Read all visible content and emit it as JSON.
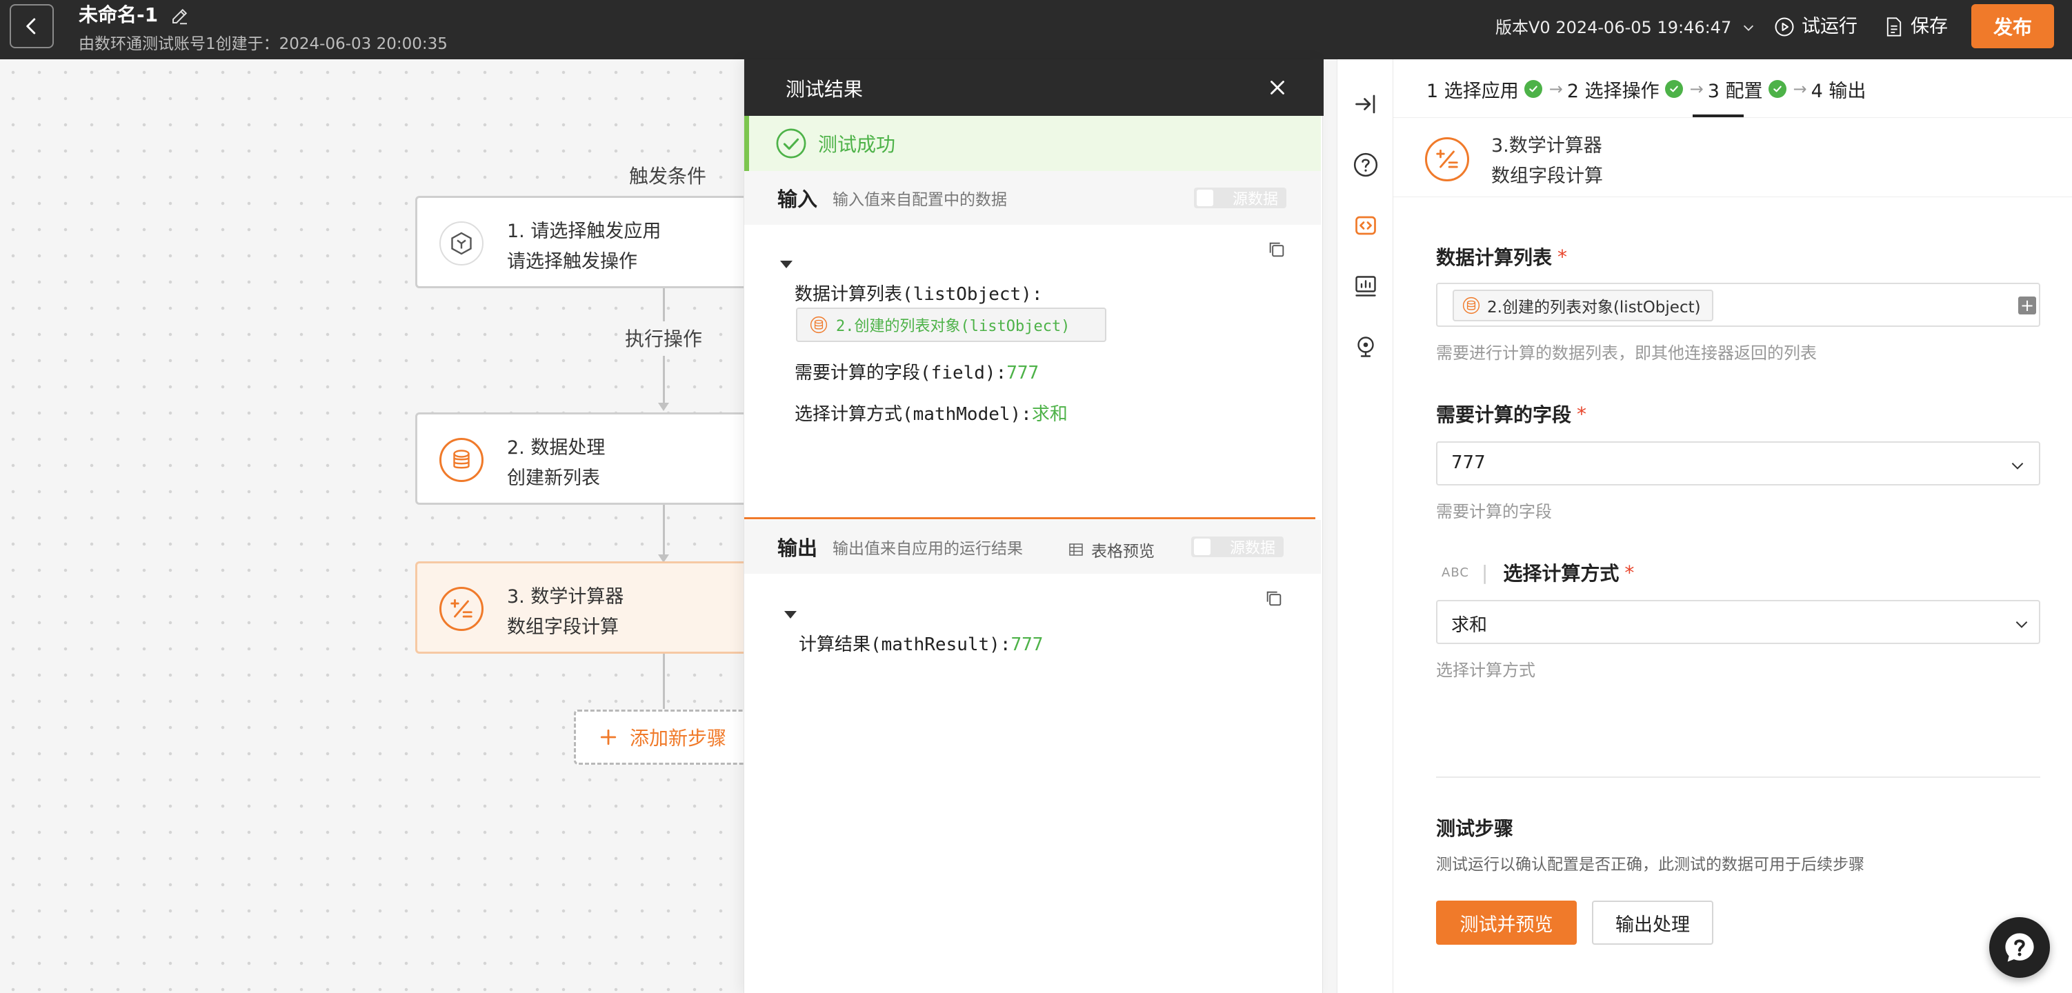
{
  "header": {
    "title": "未命名-1",
    "subtitle": "由数环通测试账号1创建于：2024-06-03 20:00:35",
    "version": "版本V0 2024-06-05 19:46:47",
    "trial_run": "试运行",
    "save": "保存",
    "publish": "发布"
  },
  "flow": {
    "trigger_label": "触发条件",
    "action_label": "执行操作",
    "nodes": [
      {
        "title": "1. 请选择触发应用",
        "sub": "请选择触发操作",
        "icon": "hexagon-app-icon"
      },
      {
        "title": "2. 数据处理",
        "sub": "创建新列表",
        "icon": "database-icon"
      },
      {
        "title": "3. 数学计算器",
        "sub": "数组字段计算",
        "icon": "calculator-icon"
      }
    ],
    "add_step": "添加新步骤"
  },
  "result": {
    "title": "测试结果",
    "success": "测试成功",
    "input": {
      "title": "输入",
      "desc": "输入值来自配置中的数据",
      "source_toggle": "源数据",
      "list_key": "数据计算列表(listObject):",
      "list_value": "2.创建的列表对象(listObject)",
      "field_key": "需要计算的字段(field):",
      "field_value": "777",
      "mode_key": "选择计算方式(mathModel):",
      "mode_value": "求和"
    },
    "output": {
      "title": "输出",
      "desc": "输出值来自应用的运行结果",
      "table_preview": "表格预览",
      "source_toggle": "源数据",
      "result_key": "计算结果(mathResult):",
      "result_value": "777"
    }
  },
  "config": {
    "steps": [
      {
        "label": "1 选择应用",
        "done": true
      },
      {
        "label": "2 选择操作",
        "done": true
      },
      {
        "label": "3 配置",
        "done": true
      },
      {
        "label": "4 输出",
        "done": false
      }
    ],
    "node_title": "3.数学计算器",
    "node_sub": "数组字段计算",
    "fields": {
      "list": {
        "label": "数据计算列表",
        "chip": "2.创建的列表对象(listObject)",
        "hint": "需要进行计算的数据列表，即其他连接器返回的列表"
      },
      "field": {
        "label": "需要计算的字段",
        "value": "777",
        "hint": "需要计算的字段"
      },
      "mode": {
        "type_tag": "ABC",
        "label": "选择计算方式",
        "value": "求和",
        "hint": "选择计算方式"
      }
    },
    "test": {
      "title": "测试步骤",
      "desc": "测试运行以确认配置是否正确，此测试的数据可用于后续步骤",
      "test_button": "测试并预览",
      "output_button": "输出处理"
    }
  },
  "colors": {
    "accent": "#f07a2a",
    "success": "#4db248",
    "header_bg": "#2b2b2b"
  }
}
